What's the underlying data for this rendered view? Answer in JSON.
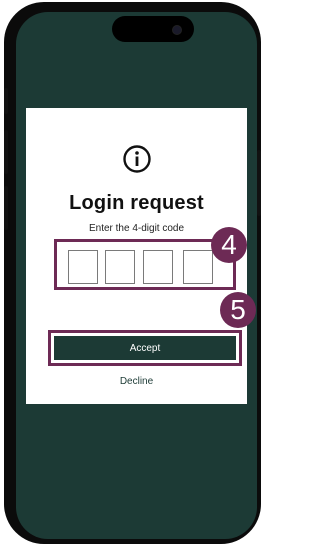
{
  "dialog": {
    "icon": "info-circle-icon",
    "title": "Login request",
    "subtitle": "Enter the 4-digit code",
    "code_digits": [
      "",
      "",
      "",
      ""
    ],
    "accept_label": "Accept",
    "decline_label": "Decline"
  },
  "annotations": {
    "step_code": "4",
    "step_accept": "5"
  },
  "colors": {
    "screen_bg": "#1c3a35",
    "accent": "#1c3a35",
    "highlight": "#6d2a55",
    "card_bg": "#ffffff"
  }
}
